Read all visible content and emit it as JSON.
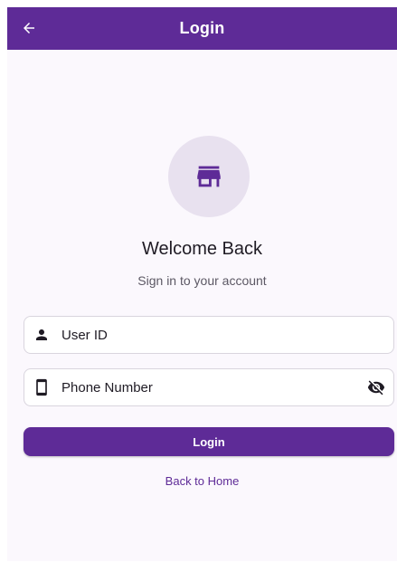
{
  "app_bar": {
    "title": "Login",
    "back_icon": "arrow-left-icon"
  },
  "header": {
    "icon": "storefront-icon",
    "welcome": "Welcome Back",
    "subtitle": "Sign in to your account"
  },
  "form": {
    "user_id": {
      "placeholder": "User ID",
      "icon": "person-icon"
    },
    "phone": {
      "placeholder": "Phone Number",
      "icon": "smartphone-icon",
      "toggle_icon": "eye-off-icon"
    },
    "login_label": "Login",
    "back_home_label": "Back to Home"
  },
  "colors": {
    "primary": "#5e2b97",
    "icon_circle": "#e8e1ef",
    "background": "#fbf8fd"
  }
}
